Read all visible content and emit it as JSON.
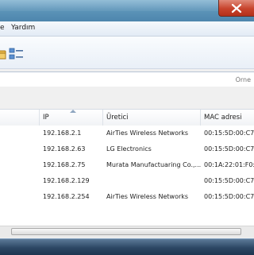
{
  "menubar": {
    "partial_item": "e",
    "help_label": "Yardım"
  },
  "search": {
    "placeholder": "Örne"
  },
  "table": {
    "columns": [
      "IP",
      "Üretici",
      "MAC adresi"
    ],
    "rows": [
      {
        "ip": "192.168.2.1",
        "vendor": "AirTies Wireless Networks",
        "mac": "00:15:5D:00:C7:"
      },
      {
        "ip": "192.168.2.63",
        "vendor": "LG Electronics",
        "mac": "00:15:5D:00:C7:"
      },
      {
        "ip": "192.168.2.75",
        "vendor": "Murata Manufactuaring Co.,...",
        "mac": "00:1A:22:01:F0:"
      },
      {
        "ip": "192.168.2.129",
        "vendor": "",
        "mac": "00:15:5D:00:C7:"
      },
      {
        "ip": "192.168.2.254",
        "vendor": "AirTies Wireless Networks",
        "mac": "00:15:5D:00:C7:"
      }
    ]
  },
  "colors": {
    "title_blue": "#5e96ba",
    "close_red": "#c7432c",
    "taskbar": "#2c4764"
  },
  "icons": {
    "toolbar_left": "folder-icon",
    "toolbar_right": "details-view-icon",
    "sort": "sort-ascending-icon"
  }
}
